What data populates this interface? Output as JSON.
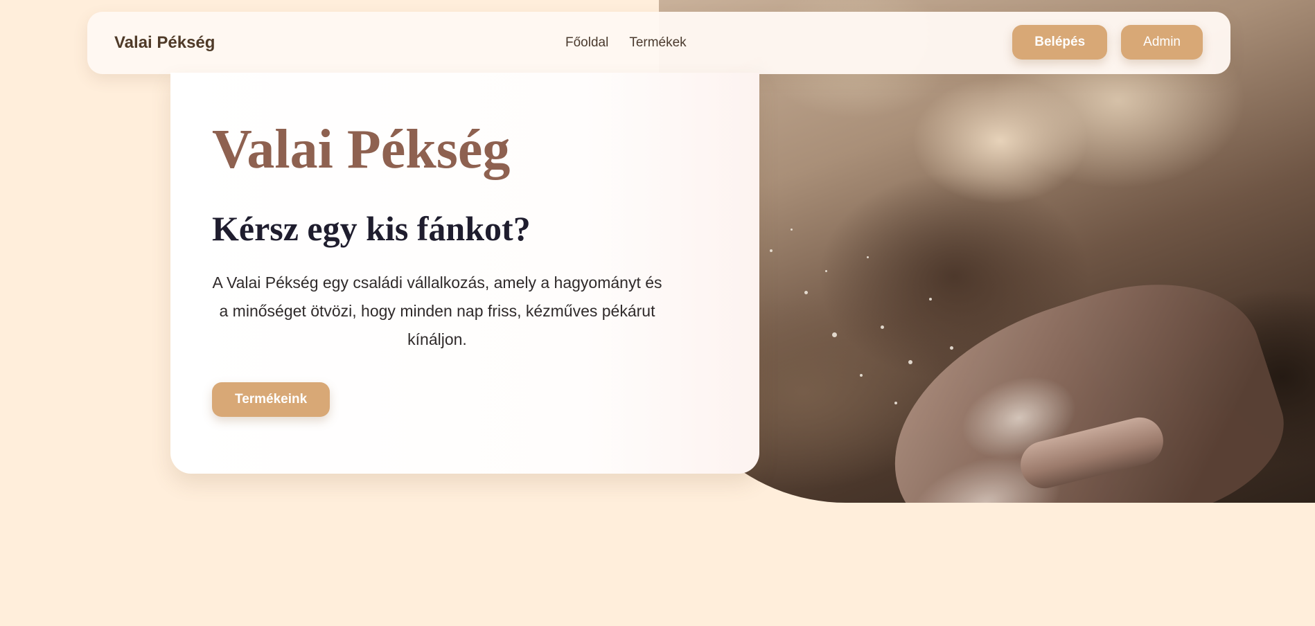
{
  "navbar": {
    "brand": "Valai Pékség",
    "links": [
      {
        "label": "Főoldal"
      },
      {
        "label": "Termékek"
      }
    ],
    "login_label": "Belépés",
    "admin_label": "Admin"
  },
  "hero": {
    "title": "Valai Pékség",
    "subtitle": "Kérsz egy kis fánkot?",
    "description": "A Valai Pékség egy családi vállalkozás, amely a hagyományt és a minőséget ötvözi, hogy minden nap friss, kézműves pékárut kínáljon.",
    "cta_label": "Termékeink"
  },
  "colors": {
    "page_background": "#ffeedb",
    "accent": "#d8a876",
    "title": "#8e6150",
    "subtitle": "#1f1d2e",
    "brand": "#4f3a28"
  },
  "icons": {
    "hero_image": "flour-hand-photo"
  }
}
